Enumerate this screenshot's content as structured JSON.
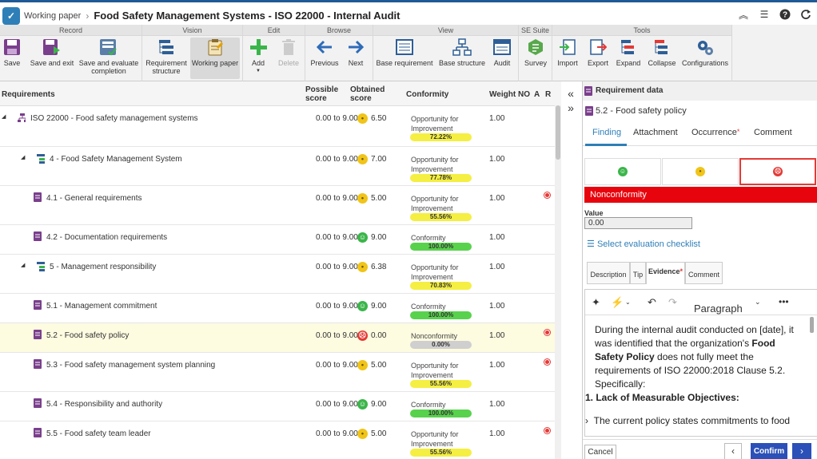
{
  "header": {
    "module": "Working paper",
    "title": "Food Safety Management Systems - ISO 22000 - Internal Audit"
  },
  "ribbon": {
    "groups": [
      "Record",
      "Vision",
      "Edit",
      "Browse",
      "View",
      "SE Suite",
      "Tools"
    ],
    "buttons": {
      "save": "Save",
      "save_exit": "Save and exit",
      "save_eval": "Save and evaluate completion",
      "req_structure": "Requirement structure",
      "working_paper": "Working paper",
      "add": "Add",
      "delete": "Delete",
      "previous": "Previous",
      "next": "Next",
      "base_req": "Base requirement",
      "base_structure": "Base structure",
      "audit": "Audit",
      "survey": "Survey",
      "import": "Import",
      "export": "Export",
      "expand": "Expand",
      "collapse": "Collapse",
      "configurations": "Configurations"
    }
  },
  "grid": {
    "columns": {
      "requirements": "Requirements",
      "possible": "Possible score",
      "obtained": "Obtained score",
      "conformity": "Conformity",
      "weight": "Weight",
      "no": "NO",
      "a": "A",
      "r": "R"
    },
    "rows": [
      {
        "name": "ISO 22000 - Food safety management systems",
        "possible": "0.00 to 9.00",
        "face": "neutral",
        "obtained": "6.50",
        "conf1": "Opportunity for",
        "conf2": "Improvement",
        "pct": "72.22%",
        "bar": "yellow",
        "weight": "1.00"
      },
      {
        "name": "4 - Food Safety Management System",
        "possible": "0.00 to 9.00",
        "face": "neutral",
        "obtained": "7.00",
        "conf1": "Opportunity for",
        "conf2": "Improvement",
        "pct": "77.78%",
        "bar": "yellow",
        "weight": "1.00"
      },
      {
        "name": "4.1 - General requirements",
        "possible": "0.00 to 9.00",
        "face": "neutral",
        "obtained": "5.00",
        "conf1": "Opportunity for",
        "conf2": "Improvement",
        "pct": "55.56%",
        "bar": "yellow",
        "weight": "1.00"
      },
      {
        "name": "4.2 - Documentation requirements",
        "possible": "0.00 to 9.00",
        "face": "happy",
        "obtained": "9.00",
        "conf1": "Conformity",
        "conf2": "",
        "pct": "100.00%",
        "bar": "green",
        "weight": "1.00"
      },
      {
        "name": "5 - Management responsibility",
        "possible": "0.00 to 9.00",
        "face": "neutral",
        "obtained": "6.38",
        "conf1": "Opportunity for",
        "conf2": "Improvement",
        "pct": "70.83%",
        "bar": "yellow",
        "weight": "1.00"
      },
      {
        "name": "5.1 - Management commitment",
        "possible": "0.00 to 9.00",
        "face": "happy",
        "obtained": "9.00",
        "conf1": "Conformity",
        "conf2": "",
        "pct": "100.00%",
        "bar": "green",
        "weight": "1.00"
      },
      {
        "name": "5.2 - Food safety policy",
        "possible": "0.00 to 9.00",
        "face": "sad",
        "obtained": "0.00",
        "conf1": "Nonconformity",
        "conf2": "",
        "pct": "0.00%",
        "bar": "gray",
        "weight": "1.00"
      },
      {
        "name": "5.3 - Food safety management system planning",
        "possible": "0.00 to 9.00",
        "face": "neutral",
        "obtained": "5.00",
        "conf1": "Opportunity for",
        "conf2": "Improvement",
        "pct": "55.56%",
        "bar": "yellow",
        "weight": "1.00"
      },
      {
        "name": "5.4 - Responsibility and authority",
        "possible": "0.00 to 9.00",
        "face": "happy",
        "obtained": "9.00",
        "conf1": "Conformity",
        "conf2": "",
        "pct": "100.00%",
        "bar": "green",
        "weight": "1.00"
      },
      {
        "name": "5.5 - Food safety team leader",
        "possible": "0.00 to 9.00",
        "face": "neutral",
        "obtained": "5.00",
        "conf1": "Opportunity for",
        "conf2": "Improvement",
        "pct": "55.56%",
        "bar": "yellow",
        "weight": "1.00"
      }
    ]
  },
  "panel": {
    "header": "Requirement data",
    "subtitle": "5.2 - Food safety policy",
    "tabs": {
      "finding": "Finding",
      "attachment": "Attachment",
      "occurrence": "Occurrence",
      "comment": "Comment"
    },
    "banner": "Nonconformity",
    "value_label": "Value",
    "value": "0.00",
    "checklist_link": "Select evaluation checklist",
    "subtabs": {
      "description": "Description",
      "tip": "Tip",
      "evidence": "Evidence",
      "comment": "Comment"
    },
    "editor": {
      "paragraph": "Paragraph",
      "p1a": "During the internal audit conducted on [date], it was identified that the organization's ",
      "p1b": "Food Safety Policy",
      "p1c": " does not fully meet the requirements of ISO 22000:2018 Clause 5.2. Specifically:",
      "li1": "Lack of Measurable Objectives:",
      "li2": "The current policy states commitments to food"
    },
    "footer": {
      "cancel": "Cancel",
      "confirm": "Confirm"
    }
  },
  "colors": {
    "accent": "#2e7fb8",
    "nonconformity": "#e8040d",
    "confirm": "#2b50b8"
  }
}
